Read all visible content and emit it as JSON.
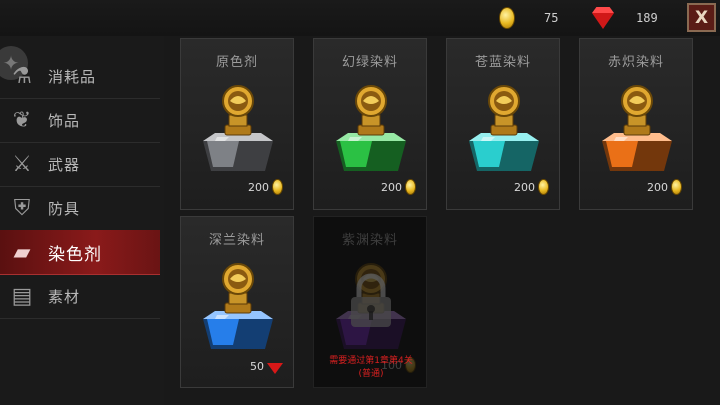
{
  "topbar": {
    "coin_icon": "gold-coin-icon",
    "coin_value": "75",
    "gem_icon": "red-gem-icon",
    "gem_value": "189",
    "close_label": "X"
  },
  "sidebar": {
    "items": [
      {
        "label": "消耗品",
        "icon": "potion-icon"
      },
      {
        "label": "饰品",
        "icon": "necklace-icon"
      },
      {
        "label": "武器",
        "icon": "sword-icon"
      },
      {
        "label": "防具",
        "icon": "armor-icon"
      },
      {
        "label": "染色剂",
        "icon": "dye-icon",
        "active": true
      },
      {
        "label": "素材",
        "icon": "material-icon"
      }
    ]
  },
  "shop": {
    "items": [
      {
        "name": "原色剂",
        "price": "200",
        "currency": "coin",
        "color": "#8a8d92"
      },
      {
        "name": "幻绿染料",
        "price": "200",
        "currency": "coin",
        "color": "#2fd24a"
      },
      {
        "name": "苍蓝染料",
        "price": "200",
        "currency": "coin",
        "color": "#2ee0e0"
      },
      {
        "name": "赤炽染料",
        "price": "200",
        "currency": "coin",
        "color": "#ff7a1a"
      },
      {
        "name": "深兰染料",
        "price": "50",
        "currency": "gem",
        "color": "#2a8aff"
      },
      {
        "name": "紫渊染料",
        "price": "100",
        "currency": "coin",
        "color": "#8a2be2",
        "locked": true,
        "lock_text_1": "需要通过第1章第4关",
        "lock_text_2": "(普通)"
      }
    ]
  }
}
